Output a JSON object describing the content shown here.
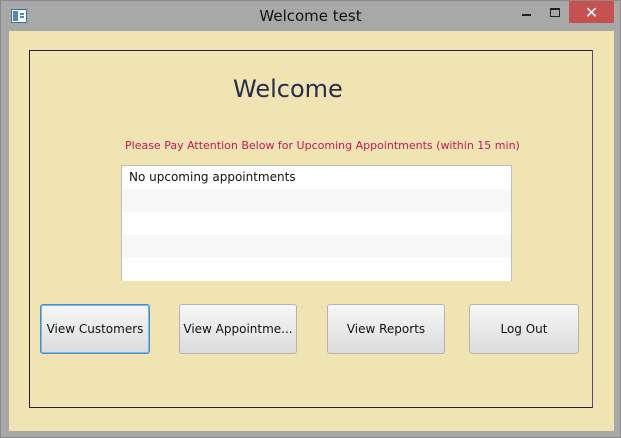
{
  "window": {
    "title": "Welcome test",
    "close_glyph": "✕"
  },
  "main": {
    "heading": "Welcome",
    "notice": "Please Pay Attention Below for Upcoming Appointments (within 15 min)",
    "appointments": [
      "No upcoming appointments",
      "",
      "",
      "",
      ""
    ]
  },
  "buttons": {
    "view_customers": "View Customers",
    "view_appointments": "View Appointme...",
    "view_reports": "View Reports",
    "log_out": "Log Out"
  },
  "colors": {
    "background": "#f0e4b2",
    "notice_text": "#c2185b",
    "close_button": "#c75050"
  }
}
